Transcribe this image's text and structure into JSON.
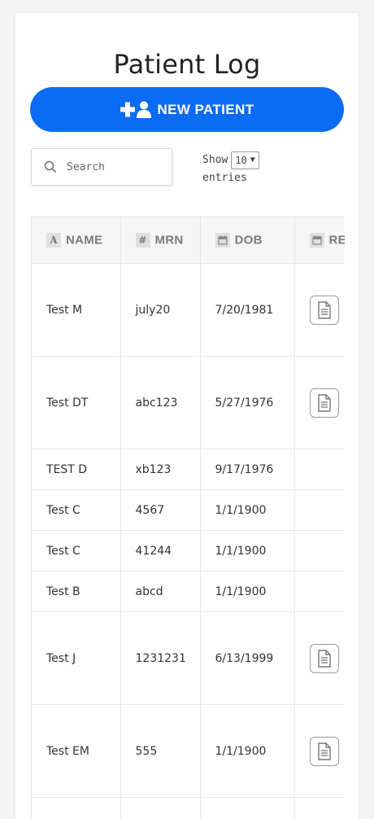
{
  "page": {
    "title": "Patient Log"
  },
  "toolbar": {
    "new_patient_label": "NEW PATIENT",
    "search_placeholder": "Search",
    "show_label": "Show",
    "entries_value": "10",
    "entries_label": "entries"
  },
  "table": {
    "columns": [
      {
        "label": "NAME",
        "icon": "A"
      },
      {
        "label": "MRN",
        "icon": "#"
      },
      {
        "label": "DOB",
        "icon": "calendar-icon"
      },
      {
        "label": "RE",
        "icon": "calendar-icon"
      }
    ],
    "rows": [
      {
        "name": "Test M",
        "mrn": "july20",
        "dob": "7/20/1981",
        "has_report": true
      },
      {
        "name": "Test DT",
        "mrn": "abc123",
        "dob": "5/27/1976",
        "has_report": true
      },
      {
        "name": "TEST D",
        "mrn": "xb123",
        "dob": "9/17/1976",
        "has_report": false
      },
      {
        "name": "Test C",
        "mrn": "4567",
        "dob": "1/1/1900",
        "has_report": false
      },
      {
        "name": "Test C",
        "mrn": "41244",
        "dob": "1/1/1900",
        "has_report": false
      },
      {
        "name": "Test B",
        "mrn": "abcd",
        "dob": "1/1/1900",
        "has_report": false
      },
      {
        "name": "Test J",
        "mrn": "1231231",
        "dob": "6/13/1999",
        "has_report": true
      },
      {
        "name": "Test EM",
        "mrn": "555",
        "dob": "1/1/1900",
        "has_report": true
      },
      {
        "name": "",
        "mrn": "",
        "dob": "",
        "has_report": false
      }
    ]
  },
  "colors": {
    "primary": "#0a6cf5",
    "header_bg": "#f6f6f6",
    "border": "#e6e6e6"
  }
}
